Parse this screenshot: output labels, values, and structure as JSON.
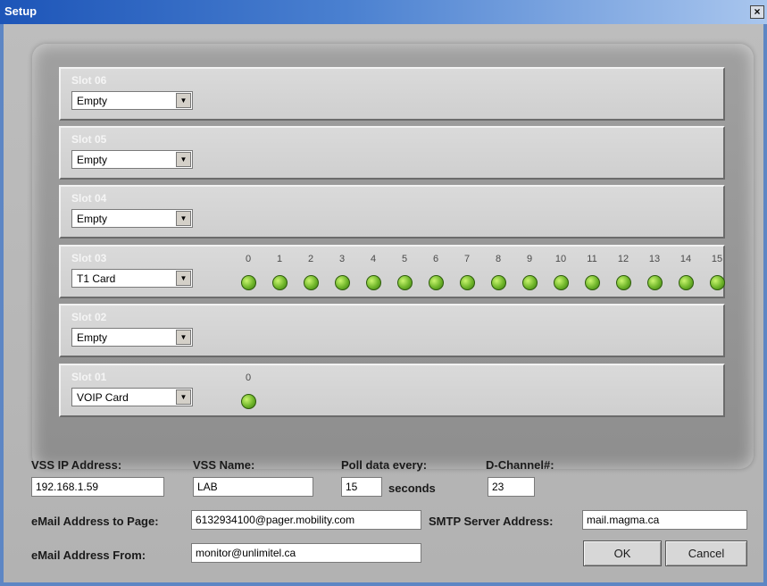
{
  "window": {
    "title": "Setup",
    "close_glyph": "×"
  },
  "slots": [
    {
      "name": "Slot 06",
      "card": "Empty",
      "channels": []
    },
    {
      "name": "Slot 05",
      "card": "Empty",
      "channels": []
    },
    {
      "name": "Slot 04",
      "card": "Empty",
      "channels": []
    },
    {
      "name": "Slot 03",
      "card": "T1 Card",
      "channels": [
        "0",
        "1",
        "2",
        "3",
        "4",
        "5",
        "6",
        "7",
        "8",
        "9",
        "10",
        "11",
        "12",
        "13",
        "14",
        "15"
      ]
    },
    {
      "name": "Slot 02",
      "card": "Empty",
      "channels": []
    },
    {
      "name": "Slot 01",
      "card": "VOIP Card",
      "channels": [
        "0"
      ]
    }
  ],
  "form": {
    "vss_ip_label": "VSS IP Address:",
    "vss_ip": "192.168.1.59",
    "vss_name_label": "VSS Name:",
    "vss_name": "LAB",
    "poll_label": "Poll data every:",
    "poll_value": "15",
    "poll_unit": "seconds",
    "dchannel_label": "D-Channel#:",
    "dchannel": "23",
    "email_page_label": "eMail Address to Page:",
    "email_page": "6132934100@pager.mobility.com",
    "smtp_label": "SMTP Server Address:",
    "smtp": "mail.magma.ca",
    "email_from_label": "eMail Address From:",
    "email_from": "monitor@unlimitel.ca"
  },
  "buttons": {
    "ok": "OK",
    "cancel": "Cancel"
  },
  "colors": {
    "led_on": "#6fb52a",
    "title_bar": "#1d55b8"
  }
}
